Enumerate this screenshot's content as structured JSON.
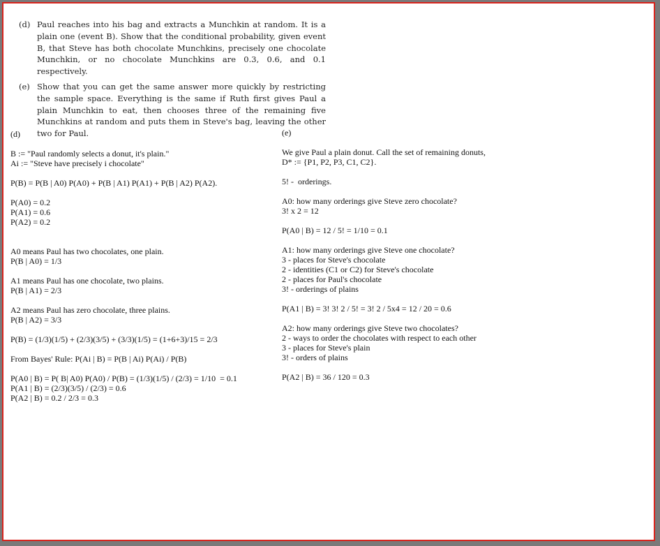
{
  "problem": {
    "d": {
      "label": "(d)",
      "text": "Paul reaches into his bag and extracts a Munchkin at random. It is a plain one (event B). Show that the conditional probability, given event B, that Steve has both chocolate Munchkins, precisely one chocolate Munchkin, or no chocolate Munchkins are 0.3, 0.6, and 0.1 respectively."
    },
    "e": {
      "label": "(e)",
      "text": "Show that you can get the same answer more quickly by restricting the sample space. Everything is the same if Ruth first gives Paul a plain Munchkin to eat, then chooses three of the remaining five Munchkins at random and puts them in Steve's bag, leaving the other two for Paul."
    }
  },
  "left": {
    "heading": "(d)",
    "def_b": "B := \"Paul randomly selects a donut, it's plain.\"",
    "def_ai": "Ai := \"Steve have precisely i chocolate\"",
    "total_prob": "P(B) = P(B | A0) P(A0) + P(B | A1) P(A1) + P(B | A2) P(A2).",
    "pa0": "P(A0) = 0.2",
    "pa1": "P(A1) = 0.6",
    "pa2": "P(A2) = 0.2",
    "a0_desc": "A0 means Paul has two chocolates, one plain.",
    "a0_prob": "P(B | A0) = 1/3",
    "a1_desc": "A1 means Paul has one chocolate, two plains.",
    "a1_prob": "P(B | A1) = 2/3",
    "a2_desc": "A2 means Paul has zero chocolate, three plains.",
    "a2_prob": "P(B | A2) = 3/3",
    "pb_calc": "P(B) = (1/3)(1/5) + (2/3)(3/5) + (3/3)(1/5) = (1+6+3)/15 = 2/3",
    "bayes": "From Bayes' Rule: P(Ai | B) = P(B | Ai) P(Ai) / P(B)",
    "post_a0": "P(A0 | B) = P( B| A0) P(A0) / P(B) = (1/3)(1/5) / (2/3) = 1/10  = 0.1",
    "post_a1": "P(A1 | B) = (2/3)(3/5) / (2/3) = 0.6",
    "post_a2": "P(A2 | B) = 0.2 / 2/3 = 0.3"
  },
  "right": {
    "heading": "(e)",
    "intro1": "We give Paul a plain donut. Call the set of remaining donuts,",
    "intro2": "D* := {P1, P2, P3, C1, C2}.",
    "orderings": "5! -  orderings.",
    "a0_q": "A0: how many orderings give Steve zero chocolate?",
    "a0_count": "3! x 2 = 12",
    "a0_result": "P(A0 | B) = 12 / 5! = 1/10 = 0.1",
    "a1_q": "A1: how many orderings give Steve one chocolate?",
    "a1_l1": "3 - places for Steve's chocolate",
    "a1_l2": "2 - identities (C1 or C2) for Steve's chocolate",
    "a1_l3": "2 - places for Paul's chocolate",
    "a1_l4": "3! - orderings of plains",
    "a1_result": "P(A1 | B) = 3! 3! 2 / 5! = 3! 2 / 5x4 = 12 / 20 = 0.6",
    "a2_q": "A2: how many orderings give Steve two chocolates?",
    "a2_l1": "2 - ways to order the chocolates with respect to each other",
    "a2_l2": "3 - places for Steve's plain",
    "a2_l3": "3! - orders of plains",
    "a2_result": "P(A2 | B) = 36 / 120 = 0.3"
  }
}
